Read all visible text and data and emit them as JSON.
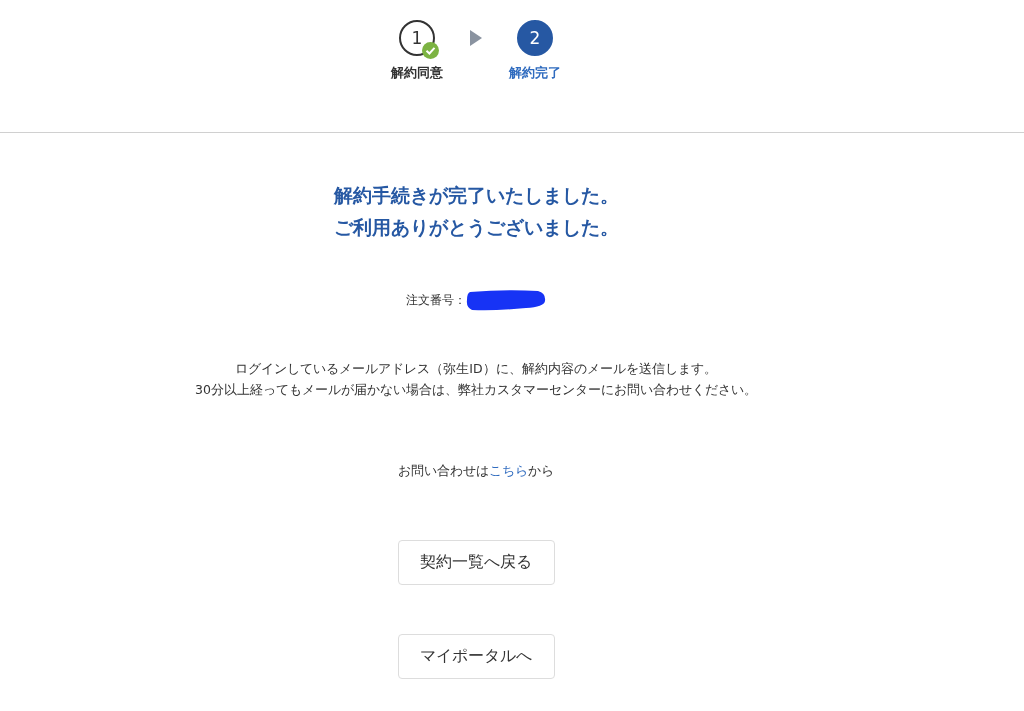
{
  "steps": [
    {
      "number": "1",
      "label": "解約同意",
      "selected": false,
      "completed": true
    },
    {
      "number": "2",
      "label": "解約完了",
      "selected": true,
      "completed": false
    }
  ],
  "heading": [
    "解約手続きが完了いたしました。",
    "ご利用ありがとうございました。"
  ],
  "order_number": {
    "label": "注文番号：",
    "redacted": true
  },
  "notice": [
    "ログインしているメールアドレス（弥生ID）に、解約内容のメールを送信します。",
    "30分以上経ってもメールが届かない場合は、弊社カスタマーセンターにお問い合わせください。"
  ],
  "contact": {
    "before": "お問い合わせは",
    "link": "こちら",
    "after": "から"
  },
  "buttons": [
    "契約一覧へ戻る",
    "マイポータルへ"
  ]
}
